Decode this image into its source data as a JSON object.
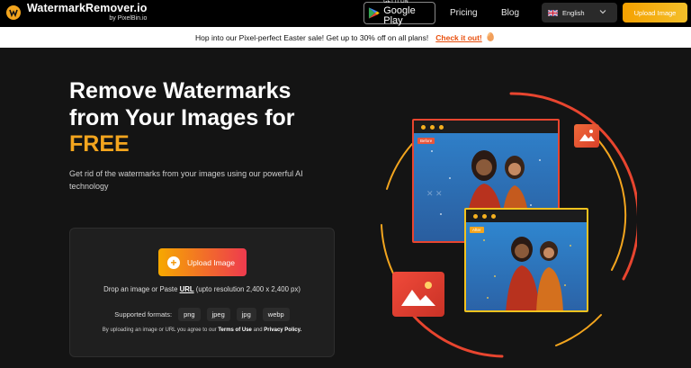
{
  "header": {
    "logo_title": "WatermarkRemover.io",
    "logo_sub": "by PixelBin.io",
    "gplay_small": "GET IT ON",
    "gplay_big": "Google Play",
    "nav": [
      "Pricing",
      "Blog"
    ],
    "language": "English",
    "upload_label": "Upload Image"
  },
  "promo": {
    "text": "Hop into our Pixel-perfect Easter sale! Get up to 30% off on all plans!",
    "link": "Check it out!"
  },
  "hero": {
    "title": "Remove Watermarks from Your Images for",
    "free": "FREE",
    "description": "Get rid of the watermarks from your images using our powerful AI technology"
  },
  "upload_card": {
    "button_label": "Upload Image",
    "drop_prefix": "Drop an image or Paste ",
    "drop_url": "URL",
    "drop_suffix": " (upto resolution 2,400 x 2,400 px)",
    "formats_label": "Supported formats:",
    "formats": [
      "png",
      "jpeg",
      "jpg",
      "webp"
    ],
    "terms_prefix": "By uploading an image or URL you agree to our ",
    "terms_link": "Terms of Use",
    "terms_and": " and ",
    "privacy_link": "Privacy Policy."
  },
  "illustration": {
    "before_tag": "Before",
    "after_tag": "After"
  },
  "colors": {
    "accent": "#f3a51e",
    "promo_link": "#e9500e",
    "background": "#141414"
  }
}
